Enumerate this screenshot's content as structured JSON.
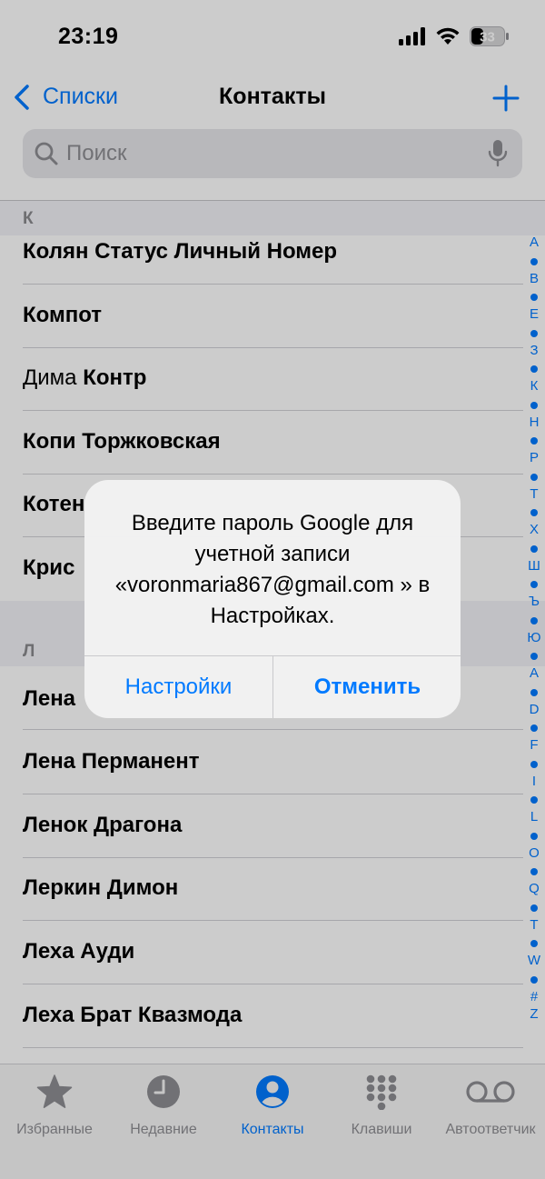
{
  "status": {
    "time": "23:19",
    "battery": "33"
  },
  "nav": {
    "back_label": "Списки",
    "title": "Контакты"
  },
  "search": {
    "placeholder": "Поиск"
  },
  "sections": [
    {
      "letter": "К",
      "header": "К"
    },
    {
      "letter": "Л",
      "header": "Л"
    }
  ],
  "contacts_k": [
    {
      "first": "Колян Статус Личный Номер",
      "last": ""
    },
    {
      "first": "Компот",
      "last": ""
    },
    {
      "first": "Дима ",
      "last": "Контр"
    },
    {
      "first": "Копи Торжковская",
      "last": ""
    },
    {
      "first": "Котен",
      "last": ""
    },
    {
      "first": "Крис",
      "last": ""
    }
  ],
  "contacts_l": [
    {
      "first": "Лена",
      "last": ""
    },
    {
      "first": "Лена Перманент",
      "last": ""
    },
    {
      "first": "Ленок Драгона",
      "last": ""
    },
    {
      "first": "Леркин Димон",
      "last": ""
    },
    {
      "first": "Леха Ауди",
      "last": ""
    },
    {
      "first": "Леха Брат Квазмода",
      "last": ""
    }
  ],
  "index": [
    "А",
    "•",
    "В",
    "•",
    "Е",
    "•",
    "З",
    "•",
    "К",
    "•",
    "Н",
    "•",
    "Р",
    "•",
    "Т",
    "•",
    "Х",
    "•",
    "Ш",
    "•",
    "Ъ",
    "•",
    "Ю",
    "•",
    "A",
    "•",
    "D",
    "•",
    "F",
    "•",
    "I",
    "•",
    "L",
    "•",
    "O",
    "•",
    "Q",
    "•",
    "T",
    "•",
    "W",
    "•",
    "#",
    "Z"
  ],
  "alert": {
    "message": "Введите пароль Google для учетной записи «voronmaria867@gmail.com » в Настройках.",
    "button_settings": "Настройки",
    "button_cancel": "Отменить"
  },
  "tabs": [
    {
      "label": "Избранные",
      "icon": "star-icon",
      "active": false
    },
    {
      "label": "Недавние",
      "icon": "clock-icon",
      "active": false
    },
    {
      "label": "Контакты",
      "icon": "person-circle-icon",
      "active": true
    },
    {
      "label": "Клавиши",
      "icon": "keypad-icon",
      "active": false
    },
    {
      "label": "Автоответчик",
      "icon": "voicemail-icon",
      "active": false
    }
  ],
  "colors": {
    "accent": "#007aff",
    "secondary_text": "#8e8e93"
  }
}
